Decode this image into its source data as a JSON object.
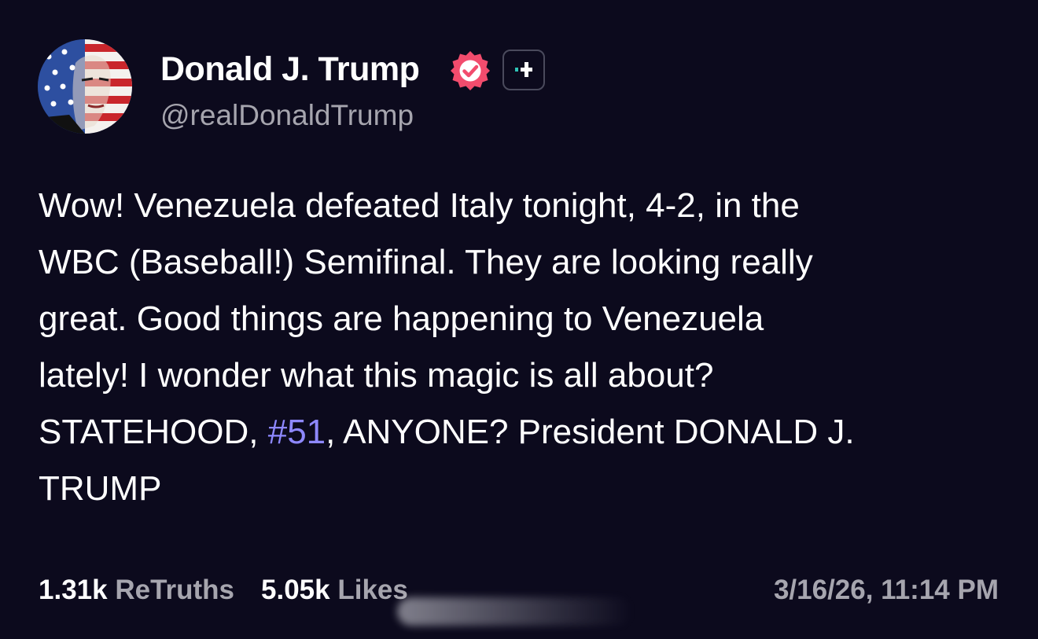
{
  "author": {
    "display_name": "Donald J. Trump",
    "handle": "@realDonaldTrump",
    "avatar_icon": "flag-portrait-avatar",
    "verified_icon": "verified-check-icon",
    "plus_icon": "follow-plus-icon",
    "verified_color": "#f24c6d"
  },
  "post": {
    "lines": [
      "Wow! Venezuela defeated Italy tonight, 4-2, in the",
      "WBC (Baseball!) Semifinal. They are looking really",
      "great. Good things are happening to Venezuela",
      "lately! I wonder what this magic is all about?"
    ],
    "line5_before": "STATEHOOD, ",
    "hashtag": "#51",
    "line5_after": ", ANYONE? President DONALD J.",
    "line6": "TRUMP",
    "hashtag_color": "#8e88ff"
  },
  "stats": {
    "retruths_value": "1.31k",
    "retruths_label": "ReTruths",
    "likes_value": "5.05k",
    "likes_label": "Likes"
  },
  "timestamp": "3/16/26, 11:14 PM",
  "colors": {
    "background": "#0c0a1d",
    "muted_text": "#a6a5ae"
  }
}
